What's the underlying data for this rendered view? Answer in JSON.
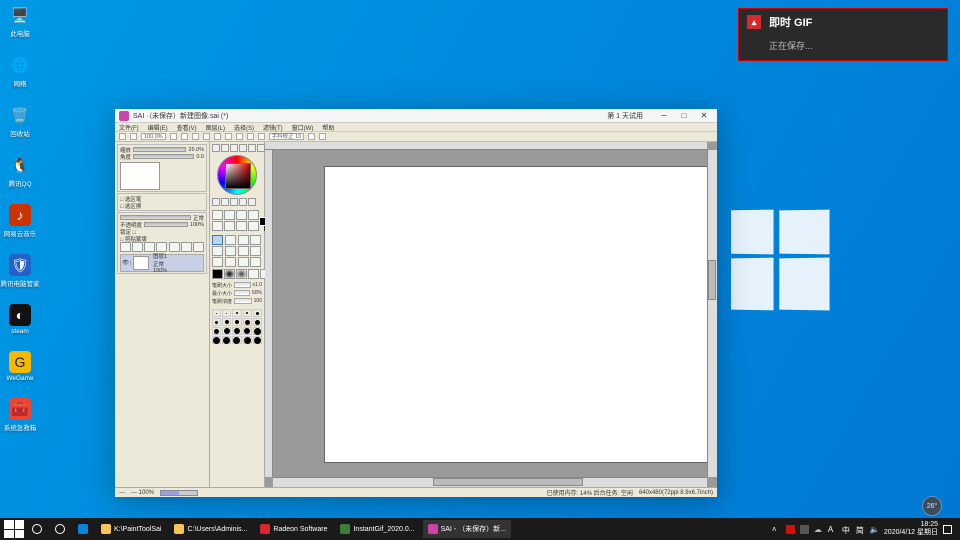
{
  "desktop": {
    "icons": [
      {
        "name": "此电脑",
        "glyph": "🖥️",
        "bg": "transparent"
      },
      {
        "name": "网络",
        "glyph": "🌐",
        "bg": "transparent"
      },
      {
        "name": "回收站",
        "glyph": "🗑️",
        "bg": "transparent"
      },
      {
        "name": "腾讯QQ",
        "glyph": "🐧",
        "bg": "transparent"
      },
      {
        "name": "网易云音乐",
        "glyph": "♪",
        "bg": "#c30"
      },
      {
        "name": "腾讯电脑管家",
        "glyph": "🛡",
        "bg": "#2363c9"
      },
      {
        "name": "steam",
        "glyph": "◐",
        "bg": "#111"
      },
      {
        "name": "WeGame",
        "glyph": "G",
        "bg": "#f5b800"
      },
      {
        "name": "系统急救箱",
        "glyph": "🧰",
        "bg": "#e43"
      }
    ]
  },
  "notification": {
    "logo": "▴",
    "title": "即时 GIF",
    "subtitle": "正在保存..."
  },
  "sai": {
    "title": "SAI ·（未保存）新建图像.sai (*)",
    "trial": "第 1 天试用",
    "win_controls": {
      "min": "─",
      "max": "□",
      "close": "✕"
    },
    "menus": [
      "文件(F)",
      "编辑(E)",
      "查看(V)",
      "图层(L)",
      "选择(S)",
      "滤镜(T)",
      "窗口(W)",
      "帮助"
    ],
    "toolbar": {
      "zoom": "100.0%",
      "stab": "手抖修正 10"
    },
    "navigator": {
      "zoom_label": "缩放",
      "zoom_val": "25.0%",
      "angle_label": "角度",
      "angle_val": "0.0"
    },
    "misc_panel": {
      "a": "□ 选区笔",
      "b": "□ 选区擦"
    },
    "layer_panel": {
      "mode": "正常",
      "opacity_label": "不透明度",
      "opacity_val": "100%",
      "lock": "锁定  □",
      "clip": "□ 剪贴蒙版",
      "layer_name": "图层1",
      "layer_mode": "正常",
      "layer_op": "100%"
    },
    "brush": {
      "size_label": "笔刷大小",
      "size_val": "  x1.0",
      "min_label": "最小大小",
      "min_val": "50%",
      "dens_label": "笔刷浓度",
      "dens_val": "100"
    },
    "status": {
      "left_a": "---",
      "left_b": "---  100%",
      "right_a": "已使用内存: 14% 后台任务: 空闲",
      "coords": "640x480(72ppi 8.9x6.7inch)"
    }
  },
  "taskbar": {
    "buttons": [
      {
        "label": "",
        "icon": "start"
      },
      {
        "label": "",
        "icon": "search"
      },
      {
        "label": "",
        "icon": "cortana"
      },
      {
        "label": "",
        "icon": "edge"
      },
      {
        "label": "K:\\PaintToolSai",
        "icon": "folder"
      },
      {
        "label": "C:\\Users\\Adminis...",
        "icon": "folder"
      },
      {
        "label": "Radeon Software",
        "icon": "amd"
      },
      {
        "label": "InstantGif_2020.0...",
        "icon": "img"
      },
      {
        "label": "SAI - （未保存）新...",
        "icon": "sai"
      }
    ],
    "tray": {
      "ime1": "A",
      "ime2": "中",
      "speaker": "🔈",
      "net": "⌨",
      "more": "简"
    },
    "clock": {
      "time": "18:25",
      "date": "2020/4/12 星期日"
    },
    "temp": "26°"
  }
}
